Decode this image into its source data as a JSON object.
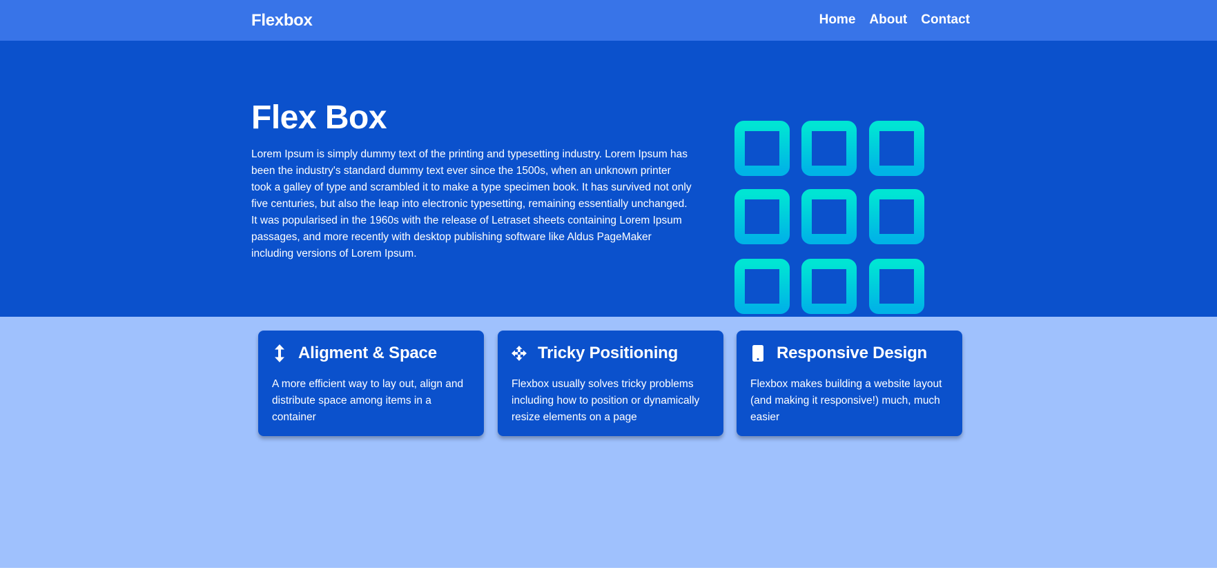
{
  "nav": {
    "brand": "Flexbox",
    "links": [
      "Home",
      "About",
      "Contact"
    ]
  },
  "hero": {
    "title": "Flex Box",
    "text": "Lorem Ipsum is simply dummy text of the printing and typesetting industry. Lorem Ipsum has been the industry's standard dummy text ever since the 1500s, when an unknown printer took a galley of type and scrambled it to make a type specimen book. It has survived not only five centuries, but also the leap into electronic typesetting, remaining essentially unchanged. It was popularised in the 1960s with the release of Letraset sheets containing Lorem Ipsum passages, and more recently with desktop publishing software like Aldus PageMaker including versions of Lorem Ipsum.",
    "graphic_icon": "grid-squares-icon"
  },
  "features": [
    {
      "icon": "vertical-arrows-icon",
      "title": "Aligment & Space",
      "text": "A more efficient way to lay out, align and distribute space among items in a container"
    },
    {
      "icon": "move-arrows-icon",
      "title": "Tricky Positioning",
      "text": "Flexbox usually solves tricky problems including how to position or dynamically resize elements on a page"
    },
    {
      "icon": "mobile-phone-icon",
      "title": "Responsive Design",
      "text": "Flexbox makes building a website layout (and making it responsive!) much, much easier"
    }
  ],
  "colors": {
    "navbar": "#3874e8",
    "hero": "#0b51cc",
    "features_bg": "#9fc1fd",
    "card": "#0b51cc",
    "grid_gradient_top": "#00e5d4",
    "grid_gradient_bottom": "#00b4e6"
  }
}
